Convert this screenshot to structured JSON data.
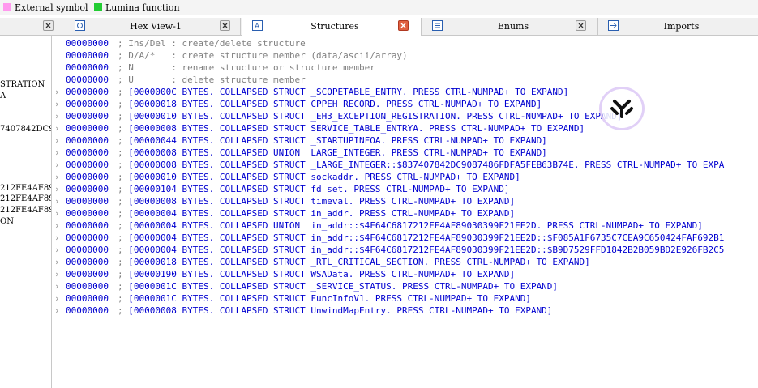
{
  "legend": [
    {
      "label": "External symbol",
      "color": "#ff99ee"
    },
    {
      "label": "Lumina function",
      "color": "#22cc33"
    }
  ],
  "tabs": [
    {
      "label": "",
      "icon": "close-icon"
    },
    {
      "label": "Hex View-1",
      "icon": "hex-view-icon"
    },
    {
      "label": "Structures",
      "icon": "structure-icon"
    },
    {
      "label": "Enums",
      "icon": "enums-icon"
    },
    {
      "label": "Imports",
      "icon": "imports-icon"
    }
  ],
  "left_pane": [
    {
      "text": "STRATION"
    },
    {
      "text": "A"
    },
    {
      "text": "7407842DC9("
    },
    {
      "text": "212FE4AF89("
    },
    {
      "text": "212FE4AF89("
    },
    {
      "text": "212FE4AF89("
    },
    {
      "text": "ON"
    }
  ],
  "comments": [
    {
      "addr": "00000000",
      "text": "; Ins/Del : create/delete structure"
    },
    {
      "addr": "00000000",
      "text": "; D/A/*   : create structure member (data/ascii/array)"
    },
    {
      "addr": "00000000",
      "text": "; N       : rename structure or structure member"
    },
    {
      "addr": "00000000",
      "text": "; U       : delete structure member"
    }
  ],
  "structs": [
    {
      "addr": "00000000",
      "text": "[0000000C BYTES. COLLAPSED STRUCT _SCOPETABLE_ENTRY. PRESS CTRL-NUMPAD+ TO EXPAND]"
    },
    {
      "addr": "00000000",
      "text": "[00000018 BYTES. COLLAPSED STRUCT CPPEH_RECORD. PRESS CTRL-NUMPAD+ TO EXPAND]"
    },
    {
      "addr": "00000000",
      "text": "[00000010 BYTES. COLLAPSED STRUCT _EH3_EXCEPTION_REGISTRATION. PRESS CTRL-NUMPAD+ TO EXPAND]"
    },
    {
      "addr": "00000000",
      "text": "[00000008 BYTES. COLLAPSED STRUCT SERVICE_TABLE_ENTRYA. PRESS CTRL-NUMPAD+ TO EXPAND]"
    },
    {
      "addr": "00000000",
      "text": "[00000044 BYTES. COLLAPSED STRUCT _STARTUPINFOA. PRESS CTRL-NUMPAD+ TO EXPAND]"
    },
    {
      "addr": "00000000",
      "text": "[00000008 BYTES. COLLAPSED UNION  LARGE_INTEGER. PRESS CTRL-NUMPAD+ TO EXPAND]"
    },
    {
      "addr": "00000000",
      "text": "[00000008 BYTES. COLLAPSED STRUCT _LARGE_INTEGER::$837407842DC9087486FDFA5FEB63B74E. PRESS CTRL-NUMPAD+ TO EXPA"
    },
    {
      "addr": "00000000",
      "text": "[00000010 BYTES. COLLAPSED STRUCT sockaddr. PRESS CTRL-NUMPAD+ TO EXPAND]"
    },
    {
      "addr": "00000000",
      "text": "[00000104 BYTES. COLLAPSED STRUCT fd_set. PRESS CTRL-NUMPAD+ TO EXPAND]"
    },
    {
      "addr": "00000000",
      "text": "[00000008 BYTES. COLLAPSED STRUCT timeval. PRESS CTRL-NUMPAD+ TO EXPAND]"
    },
    {
      "addr": "00000000",
      "text": "[00000004 BYTES. COLLAPSED STRUCT in_addr. PRESS CTRL-NUMPAD+ TO EXPAND]"
    },
    {
      "addr": "00000000",
      "text": "[00000004 BYTES. COLLAPSED UNION  in_addr::$4F64C6817212FE4AF89030399F21EE2D. PRESS CTRL-NUMPAD+ TO EXPAND]"
    },
    {
      "addr": "00000000",
      "text": "[00000004 BYTES. COLLAPSED STRUCT in_addr::$4F64C6817212FE4AF89030399F21EE2D::$F085A1F6735C7CEA9C650424FAF692B1"
    },
    {
      "addr": "00000000",
      "text": "[00000004 BYTES. COLLAPSED STRUCT in_addr::$4F64C6817212FE4AF89030399F21EE2D::$B9D7529FFD1842B2B059BD2E926FB2C5"
    },
    {
      "addr": "00000000",
      "text": "[00000018 BYTES. COLLAPSED STRUCT _RTL_CRITICAL_SECTION. PRESS CTRL-NUMPAD+ TO EXPAND]"
    },
    {
      "addr": "00000000",
      "text": "[00000190 BYTES. COLLAPSED STRUCT WSAData. PRESS CTRL-NUMPAD+ TO EXPAND]"
    },
    {
      "addr": "00000000",
      "text": "[0000001C BYTES. COLLAPSED STRUCT _SERVICE_STATUS. PRESS CTRL-NUMPAD+ TO EXPAND]"
    },
    {
      "addr": "00000000",
      "text": "[0000001C BYTES. COLLAPSED STRUCT FuncInfoV1. PRESS CTRL-NUMPAD+ TO EXPAND]"
    },
    {
      "addr": "00000000",
      "text": "[00000008 BYTES. COLLAPSED STRUCT UnwindMapEntry. PRESS CTRL-NUMPAD+ TO EXPAND]"
    }
  ],
  "struct_semicolon": ";",
  "colors": {
    "address": "#0000d0",
    "comment": "#808080",
    "struct_text": "#0000d0"
  }
}
